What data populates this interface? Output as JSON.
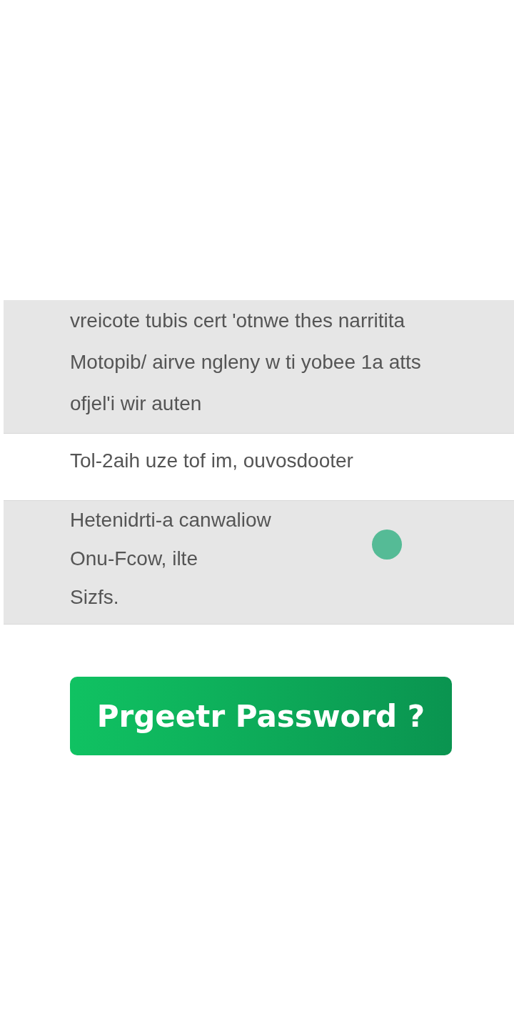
{
  "sections": [
    {
      "shaded": true,
      "lines": [
        "vreicote tubis cert 'otnwe thes narritita",
        "Motopib/ airve ngleny w ti yobee 1a atts",
        "ofjel'i wir auten"
      ]
    },
    {
      "shaded": false,
      "lines": [
        "Tol-2aih uze tof im, ouvosdooter"
      ]
    },
    {
      "shaded": true,
      "lines": [
        "Hetenidrti-a canwaliow",
        "Onu-Fcow, ilte",
        "Sizfs."
      ]
    }
  ],
  "button": {
    "label": "Prgeetr Password ?"
  }
}
